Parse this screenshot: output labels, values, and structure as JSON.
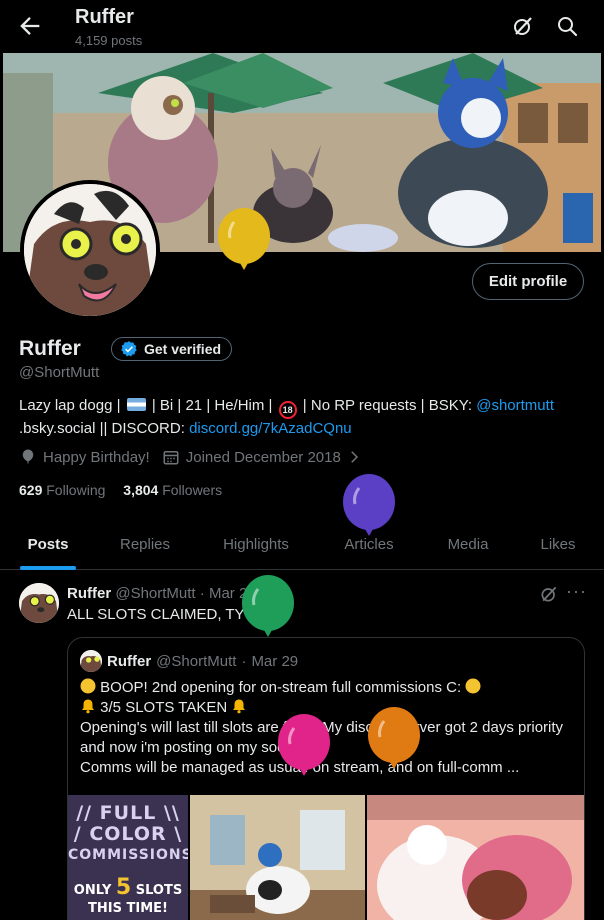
{
  "header": {
    "title": "Ruffer",
    "subtitle": "4,159 posts"
  },
  "profile": {
    "name": "Ruffer",
    "verify_label": "Get verified",
    "handle": "@ShortMutt",
    "edit_label": "Edit profile",
    "bio": {
      "part1": "Lazy lap dogg |",
      "part2": "| Bi | 21 | He/Him |",
      "eighteen": "18",
      "part3": "| No RP requests | BSKY:",
      "bsky_link": "@shortmutt",
      "part4": ".bsky.social || DISCORD:",
      "discord_link": "discord.gg/7kAzadCQnu"
    },
    "birthday": "Happy Birthday!",
    "joined": "Joined December 2018",
    "following_count": "629",
    "following_label": "Following",
    "followers_count": "3,804",
    "followers_label": "Followers"
  },
  "tabs": [
    {
      "label": "Posts"
    },
    {
      "label": "Replies"
    },
    {
      "label": "Highlights"
    },
    {
      "label": "Articles"
    },
    {
      "label": "Media"
    },
    {
      "label": "Likes"
    }
  ],
  "post": {
    "name": "Ruffer",
    "handle": "@ShortMutt",
    "sep": "·",
    "date": "Mar 29",
    "text": "ALL SLOTS CLAIMED, TY ALL!",
    "more": "···",
    "quote": {
      "name": "Ruffer",
      "handle": "@ShortMutt",
      "sep": "·",
      "date": "Mar 29",
      "line1": "BOOP! 2nd opening for on-stream full commissions C:",
      "line2": "3/5 SLOTS TAKEN",
      "line3": "Opening's will last till slots are filled! My discord server got 2 days priority and now i'm posting on my socials C:",
      "line4": "Comms will be managed as usual: on stream, and on full-comm ...",
      "promo_line1": "// FULL \\\\",
      "promo_line2": "/ COLOR \\",
      "promo_line3": "COMMISSIONS",
      "promo_line4a": "ONLY",
      "promo_num": "5",
      "promo_line4b": "SLOTS",
      "promo_line5": "THIS TIME!"
    }
  },
  "colors": {
    "accent": "#1d9bf0",
    "balloon_yellow": "#e3b91c",
    "balloon_purple": "#5b3fc4",
    "balloon_green": "#1f9e5a",
    "balloon_pink": "#e0248a",
    "balloon_orange": "#e07a12"
  }
}
